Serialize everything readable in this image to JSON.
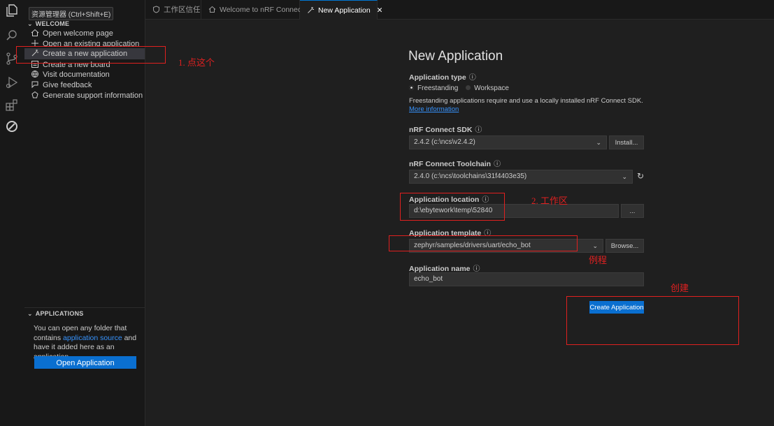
{
  "sidebar": {
    "header_tooltip": "资源管理器 (Ctrl+Shift+E)",
    "welcome": {
      "title": "WELCOME",
      "items": [
        {
          "label": "Open welcome page",
          "icon": "home-icon"
        },
        {
          "label": "Open an existing application",
          "icon": "plus-icon"
        },
        {
          "label": "Create a new application",
          "icon": "magic-wand-icon"
        },
        {
          "label": "Create a new board",
          "icon": "board-icon"
        },
        {
          "label": "Visit documentation",
          "icon": "globe-icon"
        },
        {
          "label": "Give feedback",
          "icon": "feedback-icon"
        },
        {
          "label": "Generate support information",
          "icon": "support-icon"
        }
      ]
    },
    "applications": {
      "title": "APPLICATIONS",
      "text_before": "You can open any folder that contains ",
      "link": "application source",
      "text_after": " and have it added here as an application.",
      "button": "Open Application"
    }
  },
  "tabs": [
    {
      "label": "工作区信任",
      "icon": "shield-icon",
      "active": false
    },
    {
      "label": "Welcome to nRF Connect",
      "icon": "home-icon",
      "active": false
    },
    {
      "label": "New Application",
      "icon": "magic-wand-icon",
      "active": true,
      "close": "✕"
    }
  ],
  "form": {
    "title": "New Application",
    "app_type": {
      "label": "Application type",
      "options": [
        "Freestanding",
        "Workspace"
      ],
      "selected": "Freestanding",
      "description": "Freestanding applications require and use a locally installed nRF Connect SDK.",
      "more_link": "More information"
    },
    "sdk": {
      "label": "nRF Connect SDK",
      "value": "2.4.2 (c:\\ncs\\v2.4.2)",
      "button": "Install..."
    },
    "toolchain": {
      "label": "nRF Connect Toolchain",
      "value": "2.4.0 (c:\\ncs\\toolchains\\31f4403e35)"
    },
    "location": {
      "label": "Application location",
      "value": "d:\\ebytework\\temp\\52840",
      "button": "..."
    },
    "template": {
      "label": "Application template",
      "value": "zephyr/samples/drivers/uart/echo_bot",
      "button": "Browse..."
    },
    "name": {
      "label": "Application name",
      "value": "echo_bot"
    },
    "create_button": "Create Application"
  },
  "annotations": {
    "step1": "1. 点这个",
    "step2": "2. 工作区",
    "example": "例程",
    "create": "创建"
  },
  "colors": {
    "accent": "#0a6fd0",
    "annotation_red": "#e0201f",
    "link": "#3794ff"
  }
}
